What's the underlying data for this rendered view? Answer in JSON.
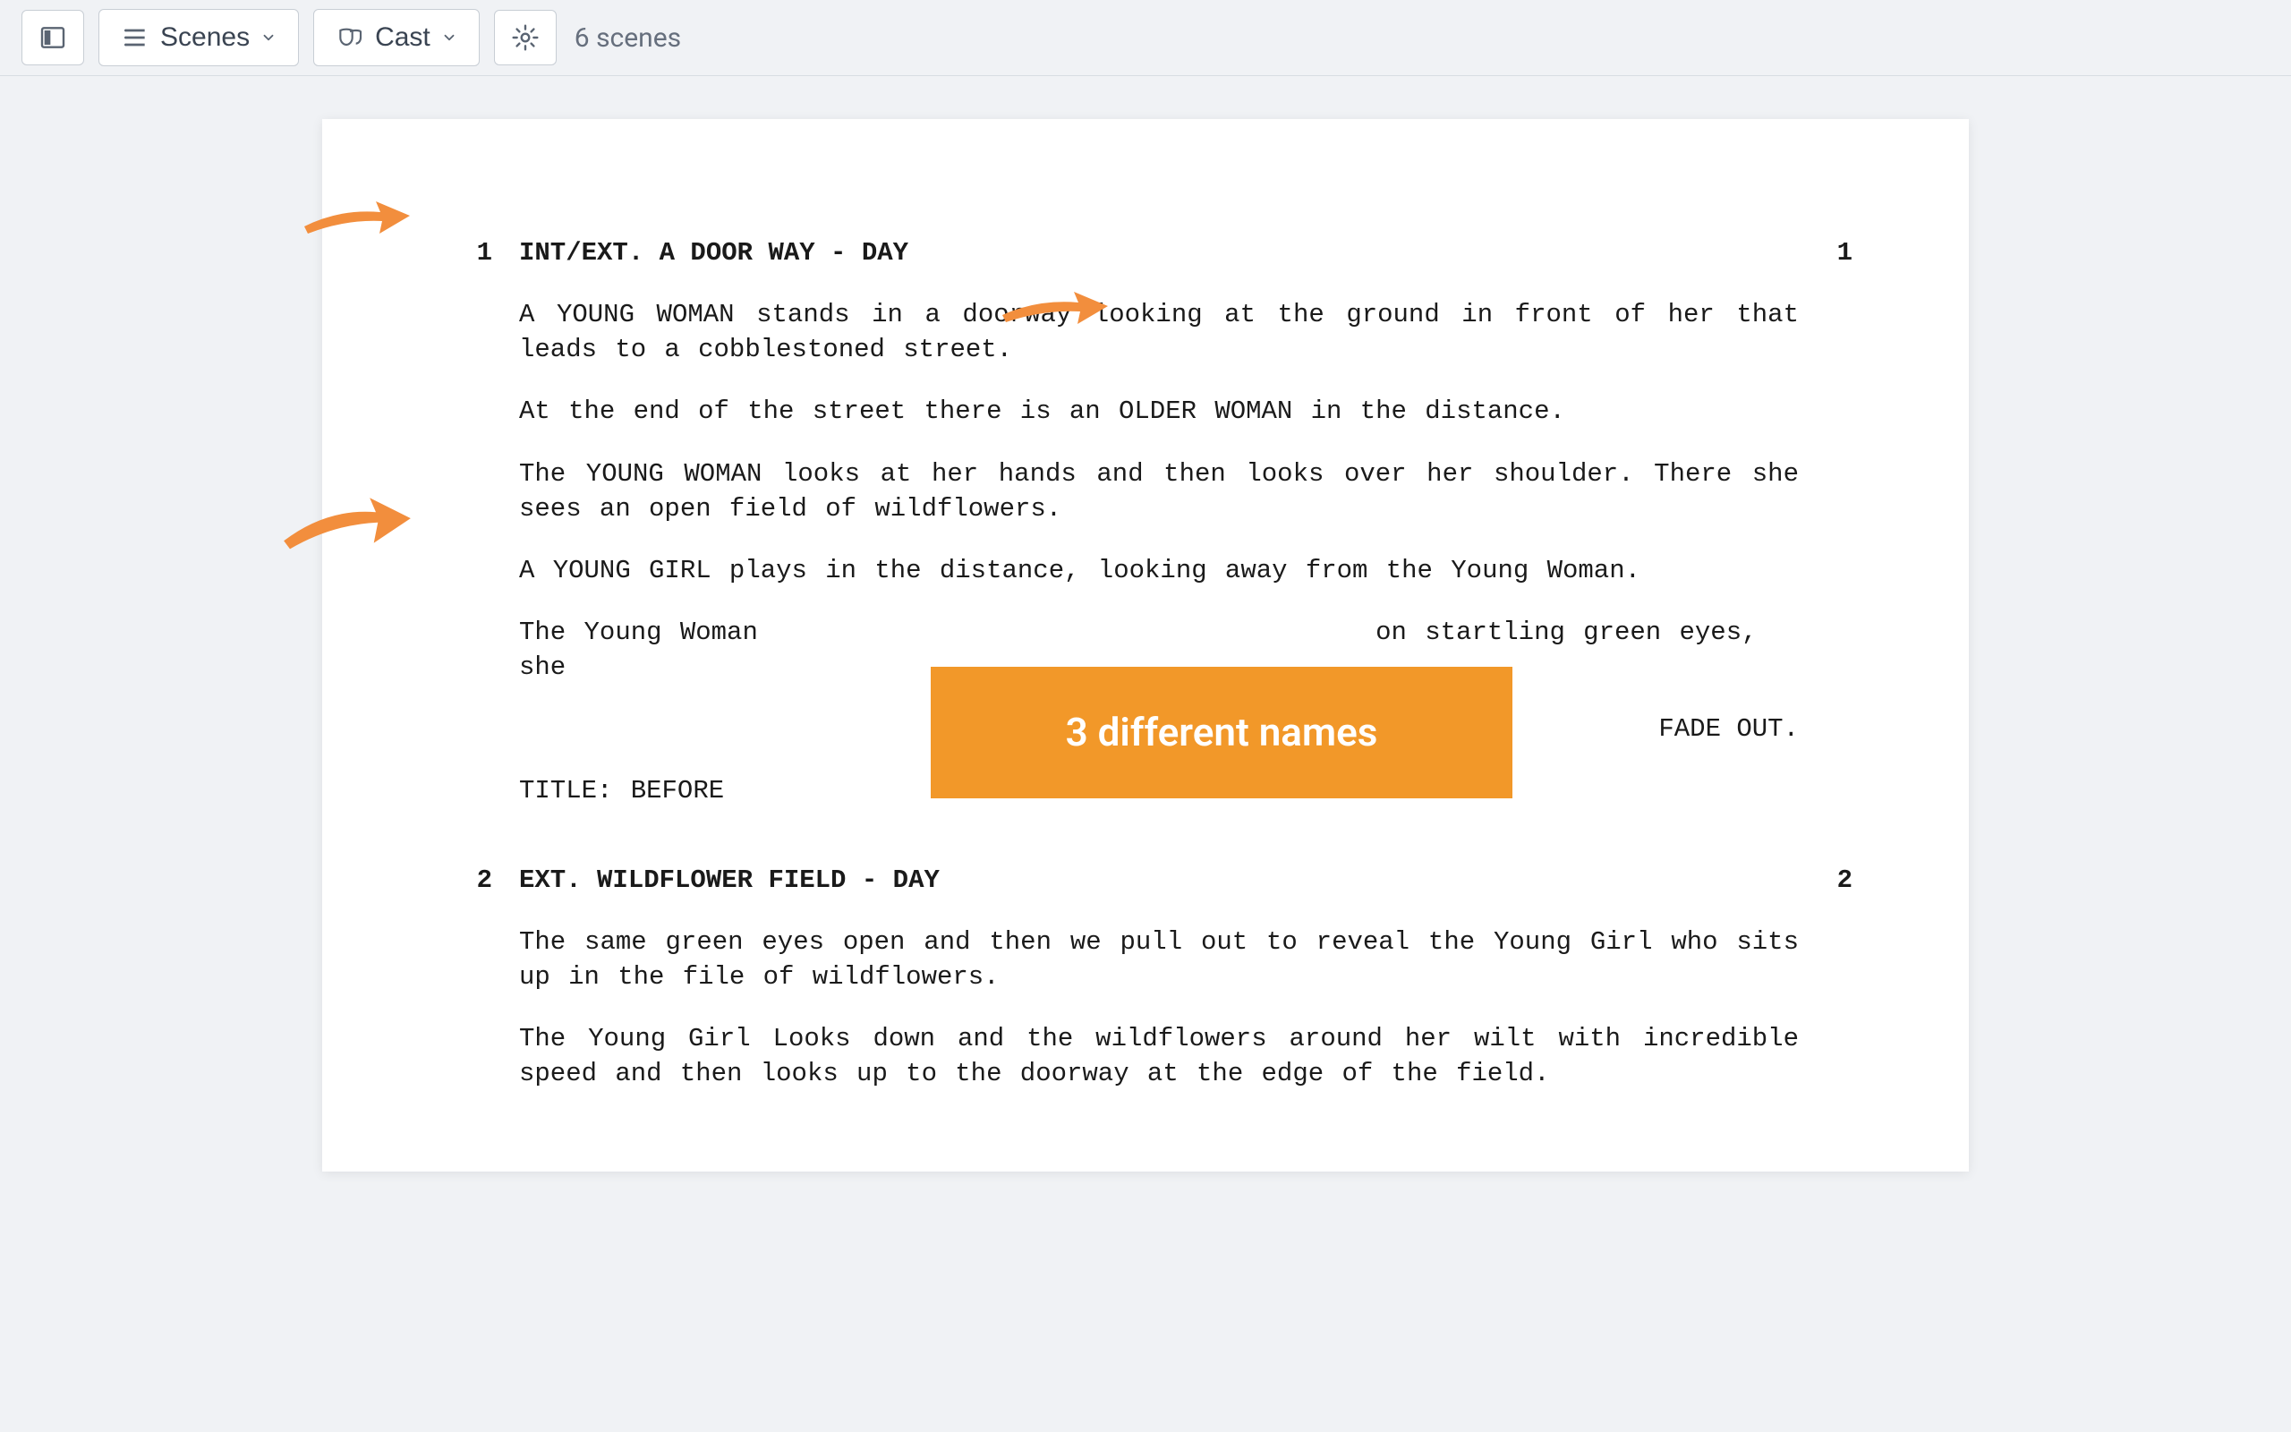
{
  "toolbar": {
    "scenes_label": "Scenes",
    "cast_label": "Cast",
    "scene_count": "6 scenes"
  },
  "script": {
    "scenes": [
      {
        "num": "1",
        "heading": "INT/EXT. A DOOR WAY - DAY",
        "paragraphs": [
          "A YOUNG WOMAN stands in a doorway looking at the ground in front of her that leads to a cobblestoned street.",
          "At the end of the street there is an OLDER WOMAN in the distance.",
          "The YOUNG WOMAN looks at her hands and then looks over her shoulder. There she sees an open field of wildflowers.",
          "A YOUNG GIRL plays in the distance, looking away from the Young Woman.",
          "The Young Woman                                  on startling green eyes, she"
        ],
        "transition": "FADE OUT.",
        "post": "TITLE: BEFORE"
      },
      {
        "num": "2",
        "heading": "EXT. WILDFLOWER FIELD - DAY",
        "paragraphs": [
          "The same green eyes open and then we pull out to reveal the Young Girl who sits up in the file of wildflowers.",
          "The Young Girl Looks down and the wildflowers around her wilt with incredible speed and then looks up to the doorway at the edge of the field."
        ]
      }
    ]
  },
  "callout": {
    "text": "3 different names"
  }
}
